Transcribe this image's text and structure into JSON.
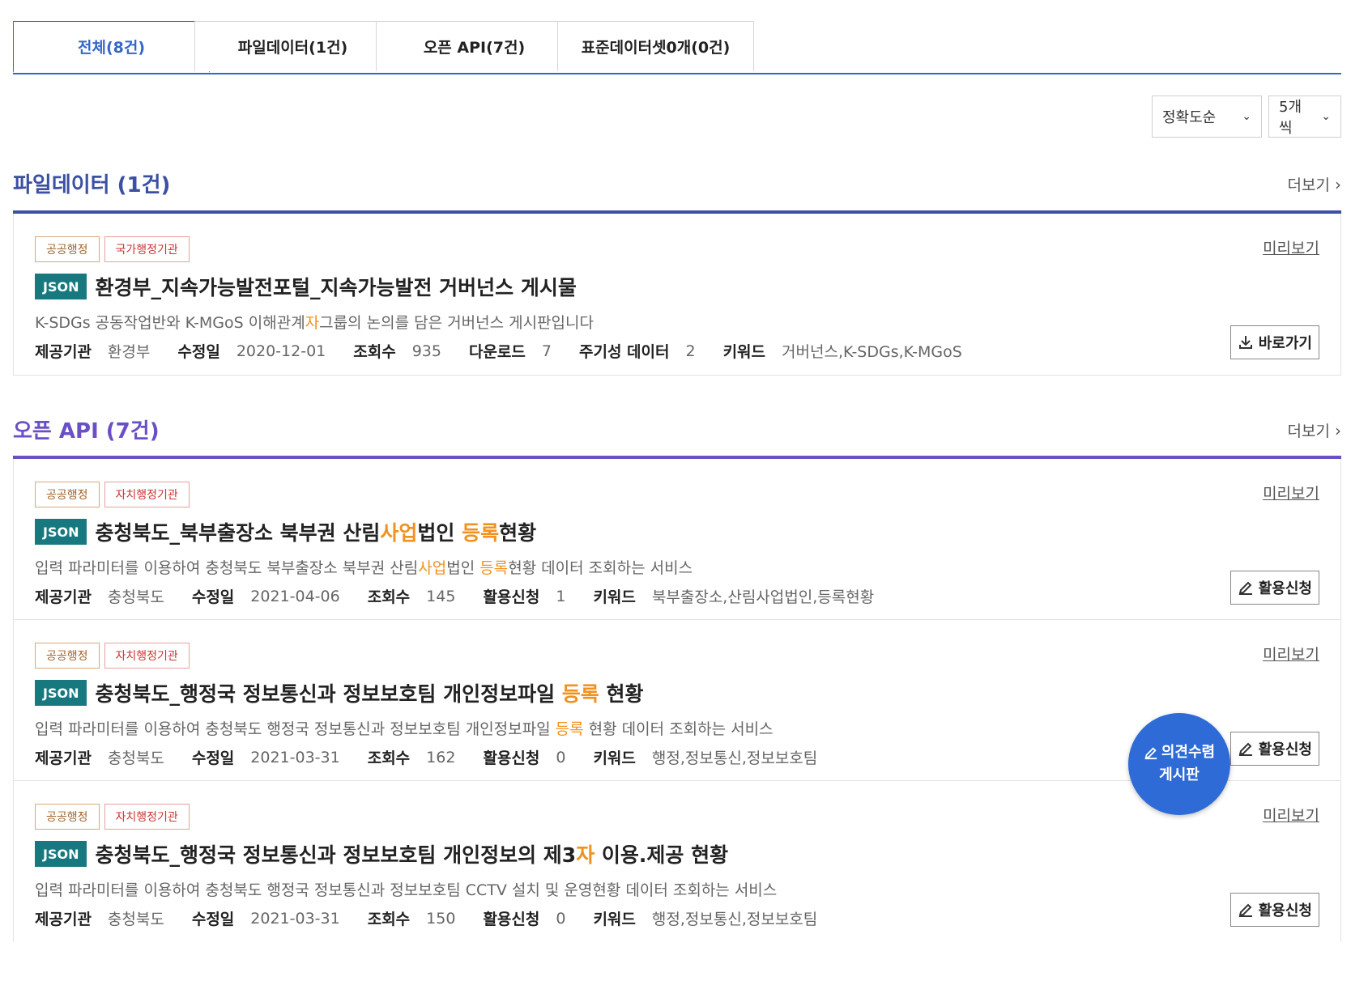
{
  "tabs": [
    {
      "label": "전체(8건)",
      "active": true
    },
    {
      "label": "파일데이터(1건)",
      "active": false
    },
    {
      "label": "오픈 API(7건)",
      "active": false
    },
    {
      "label": "표준데이터셋0개(0건)",
      "active": false
    }
  ],
  "sort": {
    "value": "정확도순",
    "count_value": "5개씩"
  },
  "icons": {
    "chevron": "chevron-down-icon",
    "more": "chevron-right-icon",
    "download": "download-icon",
    "edit": "pencil-icon"
  },
  "colors": {
    "accent": "#3567c7",
    "file_section": "#3b4fa3",
    "api_section": "#6a4fc6",
    "json_badge": "#17797f",
    "highlight": "#f0921f",
    "fab": "#2e6bd6"
  },
  "file_section": {
    "title": "파일데이터 (1건)",
    "more_label": "더보기",
    "items": [
      {
        "tag_category": "공공행정",
        "tag_org": "국가행정기관",
        "preview_label": "미리보기",
        "badge": "JSON",
        "title_parts": [
          "환경부_지속가능발전포털_지속가능발전 거버넌스 게시물",
          "",
          ""
        ],
        "desc_parts": [
          "K-SDGs 공동작업반와 K-MGoS 이해관계",
          "자",
          "그룹의 논의를 담은 거버넌스 게시판입니다"
        ],
        "meta": {
          "provider_label": "제공기관",
          "provider": "환경부",
          "modified_label": "수정일",
          "modified": "2020-12-01",
          "views_label": "조회수",
          "views": "935",
          "downloads_label": "다운로드",
          "downloads": "7",
          "periodic_label": "주기성 데이터",
          "periodic": "2",
          "keywords_label": "키워드",
          "keywords": "거버넌스,K-SDGs,K-MGoS"
        },
        "action_label": "바로가기"
      }
    ]
  },
  "api_section": {
    "title": "오픈 API (7건)",
    "more_label": "더보기",
    "items": [
      {
        "tag_category": "공공행정",
        "tag_org": "자치행정기관",
        "preview_label": "미리보기",
        "badge": "JSON",
        "title_parts": [
          "충청북도_북부출장소 북부권 산림",
          "사업",
          "법인 ",
          "등록",
          "현황"
        ],
        "desc_parts": [
          "입력 파라미터를 이용하여 충청북도 북부출장소 북부권 산림",
          "사업",
          "법인 ",
          "등록",
          "현황 데이터 조회하는 서비스"
        ],
        "meta": {
          "provider_label": "제공기관",
          "provider": "충청북도",
          "modified_label": "수정일",
          "modified": "2021-04-06",
          "views_label": "조회수",
          "views": "145",
          "apply_label": "활용신청",
          "apply": "1",
          "keywords_label": "키워드",
          "keywords": "북부출장소,산림사업법인,등록현황"
        },
        "action_label": "활용신청"
      },
      {
        "tag_category": "공공행정",
        "tag_org": "자치행정기관",
        "preview_label": "미리보기",
        "badge": "JSON",
        "title_parts": [
          "충청북도_행정국 정보통신과 정보보호팀 개인정보파일 ",
          "등록",
          " 현황",
          "",
          ""
        ],
        "desc_parts": [
          "입력 파라미터를 이용하여 충청북도 행정국 정보통신과 정보보호팀 개인정보파일 ",
          "등록",
          " 현황 데이터 조회하는 서비스",
          "",
          ""
        ],
        "meta": {
          "provider_label": "제공기관",
          "provider": "충청북도",
          "modified_label": "수정일",
          "modified": "2021-03-31",
          "views_label": "조회수",
          "views": "162",
          "apply_label": "활용신청",
          "apply": "0",
          "keywords_label": "키워드",
          "keywords": "행정,정보통신,정보보호팀"
        },
        "action_label": "활용신청"
      },
      {
        "tag_category": "공공행정",
        "tag_org": "자치행정기관",
        "preview_label": "미리보기",
        "badge": "JSON",
        "title_parts": [
          "충청북도_행정국 정보통신과 정보보호팀 개인정보의 제3",
          "자",
          " 이용.제공 현황",
          "",
          ""
        ],
        "desc_parts": [
          "입력 파라미터를 이용하여 충청북도 행정국 정보통신과 정보보호팀 CCTV 설치 및 운영현황 데이터 조회하는 서비스",
          "",
          "",
          "",
          ""
        ],
        "meta": {
          "provider_label": "제공기관",
          "provider": "충청북도",
          "modified_label": "수정일",
          "modified": "2021-03-31",
          "views_label": "조회수",
          "views": "150",
          "apply_label": "활용신청",
          "apply": "0",
          "keywords_label": "키워드",
          "keywords": "행정,정보통신,정보보호팀"
        },
        "action_label": "활용신청"
      }
    ]
  },
  "fab": {
    "line1": "의견수렴",
    "line2": "게시판"
  }
}
